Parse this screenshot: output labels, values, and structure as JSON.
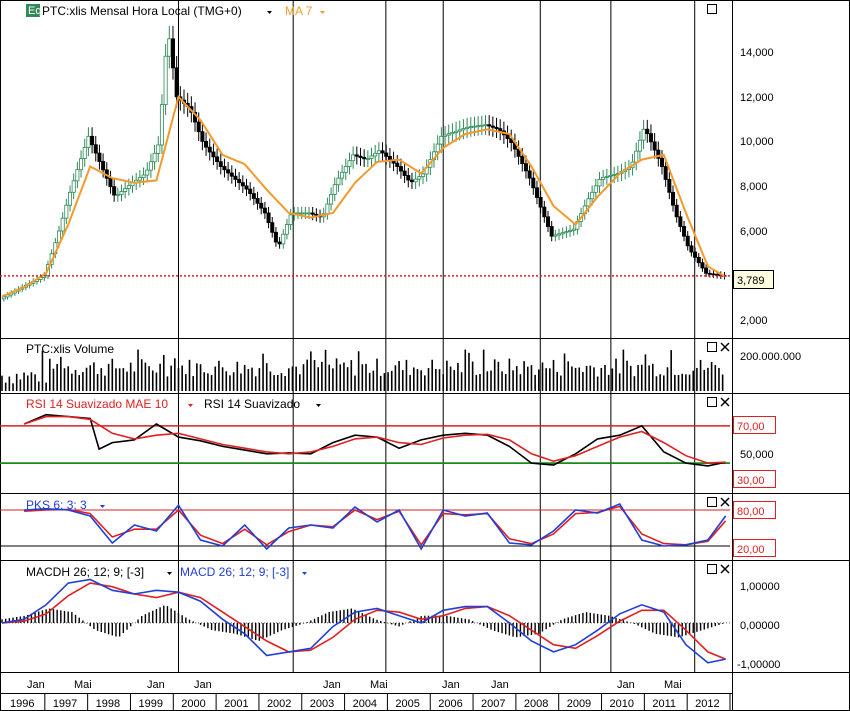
{
  "colors": {
    "up": "#2e8b57",
    "down": "#000000",
    "ma": "#f39a2b",
    "ref_line": "#d62020",
    "rsi_black": "#000000",
    "rsi_red": "#e02020",
    "pks_blue": "#1f3fd9",
    "pks_red": "#e02020",
    "macd_blue": "#1f3fd9",
    "macd_red": "#e02020",
    "oversold_line": "#1a8a1a",
    "grid": "#000000"
  },
  "icons": {
    "legend_icon": "eq-badge-icon",
    "maximize": "maximize-icon",
    "close": "close-icon",
    "dropdown": "dropdown-arrow-icon"
  },
  "panels": {
    "price": {
      "legend_badge": "Eq",
      "legend": "PTC:xlis Mensal Hora Local (TMG+0)",
      "ma_legend": "MA 7",
      "last_value": "3,789",
      "ticks": [
        "14,000",
        "12,000",
        "10,000",
        "8,000",
        "6,000",
        "2,000"
      ]
    },
    "volume": {
      "legend": "PTC:xlis Volume",
      "ticks": [
        "200.000.000"
      ]
    },
    "rsi": {
      "legend_red": "RSI 14 Suavizado MAE 10",
      "legend_black": "RSI 14 Suavizado",
      "ticks": [
        "70,00",
        "50,000",
        "30,00"
      ]
    },
    "pks": {
      "legend": "PKS 6; 3; 3",
      "ticks": [
        "80,00",
        "20,00"
      ]
    },
    "macd": {
      "legend_hist": "MACDH 26; 12; 9; [-3]",
      "legend_line": "MACD 26; 12; 9; [-3]",
      "ticks": [
        "1,00000",
        "0,00000",
        "-1,00000"
      ]
    }
  },
  "time_axis": {
    "months": [
      "Jan",
      "Mai",
      "Jan",
      "Jan",
      "Jan",
      "Mai",
      "Jan",
      "Jan",
      "Jan",
      "Mai"
    ],
    "years": [
      "1996",
      "1997",
      "1998",
      "1999",
      "2000",
      "2001",
      "2002",
      "2003",
      "2004",
      "2005",
      "2006",
      "2007",
      "2008",
      "2009",
      "2010",
      "2011",
      "2012"
    ]
  },
  "chart_data": {
    "type": "line",
    "x_range": [
      "1996",
      "2012"
    ],
    "price": {
      "y_range": [
        1200,
        15500
      ],
      "last_value": 3789,
      "series": [
        {
          "name": "PTC:xlis Mensal Hora Local (TMG+0)",
          "x": [
            1996.0,
            1996.5,
            1997.0,
            1997.3,
            1997.6,
            1998.0,
            1998.3,
            1998.6,
            1999.0,
            1999.3,
            1999.6,
            1999.8,
            2000.0,
            2000.3,
            2000.6,
            2001.0,
            2001.3,
            2001.6,
            2002.0,
            2002.3,
            2002.6,
            2003.0,
            2003.3,
            2003.6,
            2004.0,
            2004.3,
            2004.6,
            2005.0,
            2005.3,
            2005.6,
            2006.0,
            2006.3,
            2006.6,
            2007.0,
            2007.3,
            2007.6,
            2008.0,
            2008.2,
            2008.5,
            2009.0,
            2009.3,
            2009.6,
            2010.0,
            2010.3,
            2010.6,
            2011.0,
            2011.3,
            2011.6,
            2012.0,
            2012.4
          ],
          "values": [
            2800,
            3300,
            3800,
            5500,
            7500,
            9800,
            8500,
            7200,
            7800,
            8200,
            9500,
            14500,
            11500,
            11000,
            9500,
            8500,
            8000,
            7500,
            6500,
            5000,
            6500,
            6500,
            6300,
            7800,
            9000,
            8800,
            9200,
            8500,
            7800,
            8200,
            9800,
            10000,
            10200,
            10300,
            10100,
            9500,
            8000,
            7000,
            5500,
            5800,
            7000,
            8000,
            8200,
            8500,
            10200,
            8500,
            6500,
            5000,
            3900,
            3789
          ]
        },
        {
          "name": "MA 7",
          "x": [
            1996.0,
            1996.5,
            1997.0,
            1997.5,
            1998.0,
            1998.5,
            1999.0,
            1999.5,
            2000.0,
            2000.5,
            2001.0,
            2001.5,
            2002.0,
            2002.5,
            2003.0,
            2003.5,
            2004.0,
            2004.5,
            2005.0,
            2005.5,
            2006.0,
            2006.5,
            2007.0,
            2007.5,
            2008.0,
            2008.5,
            2009.0,
            2009.5,
            2010.0,
            2010.5,
            2011.0,
            2011.5,
            2012.0,
            2012.4
          ],
          "values": [
            2900,
            3300,
            3900,
            6000,
            8500,
            8000,
            7800,
            7900,
            11500,
            10500,
            9000,
            8600,
            7500,
            6500,
            6300,
            6500,
            7800,
            8700,
            8800,
            8200,
            9300,
            9900,
            10100,
            9900,
            8500,
            6800,
            6000,
            7200,
            8200,
            8800,
            9000,
            6500,
            4200,
            3750
          ]
        }
      ]
    },
    "volume": {
      "y_max": 250000000,
      "tick": 200000000
    },
    "rsi": {
      "y_range": [
        0,
        100
      ],
      "levels": [
        70,
        50,
        30
      ],
      "series": [
        {
          "name": "RSI 14 Suavizado",
          "x": [
            1996.5,
            1997.0,
            1997.5,
            1998.0,
            1998.2,
            1998.5,
            1999.0,
            1999.5,
            2000.0,
            2000.5,
            2001.0,
            2001.5,
            2002.0,
            2002.5,
            2003.0,
            2003.5,
            2004.0,
            2004.5,
            2005.0,
            2005.5,
            2006.0,
            2006.5,
            2007.0,
            2007.5,
            2008.0,
            2008.5,
            2009.0,
            2009.5,
            2010.0,
            2010.5,
            2011.0,
            2011.5,
            2012.0,
            2012.4
          ],
          "values": [
            72,
            82,
            80,
            78,
            45,
            52,
            55,
            72,
            58,
            54,
            48,
            44,
            40,
            41,
            40,
            52,
            60,
            58,
            46,
            55,
            60,
            62,
            60,
            48,
            30,
            28,
            40,
            56,
            60,
            70,
            42,
            30,
            27,
            31
          ]
        },
        {
          "name": "RSI 14 Suavizado MAE 10",
          "x": [
            1996.5,
            1997.0,
            1997.5,
            1998.0,
            1998.5,
            1999.0,
            1999.5,
            2000.0,
            2000.5,
            2001.0,
            2001.5,
            2002.0,
            2002.5,
            2003.0,
            2003.5,
            2004.0,
            2004.5,
            2005.0,
            2005.5,
            2006.0,
            2006.5,
            2007.0,
            2007.5,
            2008.0,
            2008.5,
            2009.0,
            2009.5,
            2010.0,
            2010.5,
            2011.0,
            2011.5,
            2012.0,
            2012.4
          ],
          "values": [
            72,
            80,
            80,
            77,
            62,
            56,
            60,
            62,
            56,
            50,
            46,
            42,
            40,
            42,
            48,
            56,
            58,
            52,
            50,
            57,
            60,
            61,
            55,
            40,
            32,
            38,
            48,
            58,
            64,
            52,
            38,
            30,
            31
          ]
        }
      ]
    },
    "pks": {
      "y_range": [
        0,
        100
      ],
      "levels": [
        80,
        20
      ],
      "series": [
        {
          "name": "PKS 6; 3; 3",
          "x": [
            1996.5,
            1997.0,
            1997.5,
            1998.0,
            1998.5,
            1999.0,
            1999.5,
            2000.0,
            2000.5,
            2001.0,
            2001.5,
            2002.0,
            2002.5,
            2003.0,
            2003.5,
            2004.0,
            2004.5,
            2005.0,
            2005.5,
            2006.0,
            2006.5,
            2007.0,
            2007.5,
            2008.0,
            2008.5,
            2009.0,
            2009.5,
            2010.0,
            2010.5,
            2011.0,
            2011.5,
            2012.0,
            2012.4
          ],
          "values": [
            80,
            82,
            80,
            70,
            25,
            55,
            45,
            88,
            30,
            20,
            55,
            15,
            50,
            55,
            50,
            85,
            60,
            80,
            15,
            80,
            70,
            75,
            25,
            22,
            45,
            80,
            75,
            90,
            30,
            20,
            22,
            30,
            70
          ]
        },
        {
          "name": "PKS signal",
          "x": [
            1996.5,
            1997.0,
            1997.5,
            1998.0,
            1998.5,
            1999.0,
            1999.5,
            2000.0,
            2000.5,
            2001.0,
            2001.5,
            2002.0,
            2002.5,
            2003.0,
            2003.5,
            2004.0,
            2004.5,
            2005.0,
            2005.5,
            2006.0,
            2006.5,
            2007.0,
            2007.5,
            2008.0,
            2008.5,
            2009.0,
            2009.5,
            2010.0,
            2010.5,
            2011.0,
            2011.5,
            2012.0,
            2012.4
          ],
          "values": [
            78,
            80,
            81,
            74,
            35,
            48,
            48,
            80,
            38,
            24,
            48,
            22,
            44,
            55,
            52,
            80,
            64,
            78,
            22,
            74,
            72,
            74,
            32,
            24,
            40,
            74,
            76,
            86,
            40,
            24,
            22,
            28,
            62
          ]
        }
      ]
    },
    "macd": {
      "y_range": [
        -1.3,
        1.6
      ],
      "levels": [
        0
      ],
      "series": [
        {
          "name": "MACD 26; 12; 9; [-3]",
          "x": [
            1996.0,
            1996.5,
            1997.0,
            1997.5,
            1998.0,
            1998.5,
            1999.0,
            1999.5,
            2000.0,
            2000.5,
            2001.0,
            2001.5,
            2002.0,
            2002.5,
            2003.0,
            2003.5,
            2004.0,
            2004.5,
            2005.0,
            2005.5,
            2006.0,
            2006.5,
            2007.0,
            2007.5,
            2008.0,
            2008.5,
            2009.0,
            2009.5,
            2010.0,
            2010.5,
            2011.0,
            2011.5,
            2012.0,
            2012.4
          ],
          "values": [
            0.0,
            0.1,
            0.5,
            1.1,
            1.2,
            0.9,
            0.8,
            0.9,
            0.85,
            0.6,
            0.1,
            -0.3,
            -0.9,
            -0.8,
            -0.7,
            -0.1,
            0.3,
            0.4,
            0.2,
            0.0,
            0.35,
            0.45,
            0.45,
            0.0,
            -0.5,
            -0.8,
            -0.6,
            -0.2,
            0.25,
            0.5,
            0.3,
            -0.6,
            -1.1,
            -1.0
          ]
        },
        {
          "name": "MACD signal",
          "x": [
            1996.0,
            1996.5,
            1997.0,
            1997.5,
            1998.0,
            1998.5,
            1999.0,
            1999.5,
            2000.0,
            2000.5,
            2001.0,
            2001.5,
            2002.0,
            2002.5,
            2003.0,
            2003.5,
            2004.0,
            2004.5,
            2005.0,
            2005.5,
            2006.0,
            2006.5,
            2007.0,
            2007.5,
            2008.0,
            2008.5,
            2009.0,
            2009.5,
            2010.0,
            2010.5,
            2011.0,
            2011.5,
            2012.0,
            2012.4
          ],
          "values": [
            0.0,
            0.05,
            0.25,
            0.75,
            1.1,
            1.0,
            0.8,
            0.7,
            0.85,
            0.7,
            0.3,
            -0.1,
            -0.5,
            -0.8,
            -0.75,
            -0.4,
            0.1,
            0.35,
            0.3,
            0.1,
            0.2,
            0.4,
            0.45,
            0.2,
            -0.2,
            -0.6,
            -0.7,
            -0.35,
            0.05,
            0.35,
            0.35,
            -0.2,
            -0.8,
            -1.0
          ]
        }
      ],
      "histogram": [
        0.1,
        0.2,
        0.4,
        0.3,
        -0.2,
        -0.4,
        0.2,
        0.5,
        0.1,
        -0.2,
        -0.3,
        -0.5,
        -0.2,
        0.0,
        0.3,
        0.4,
        0.1,
        -0.1,
        0.2,
        0.2,
        0.1,
        -0.2,
        -0.4,
        -0.3,
        0.1,
        0.3,
        0.2,
        0.0,
        -0.3,
        -0.4,
        -0.2,
        0.0
      ]
    }
  }
}
